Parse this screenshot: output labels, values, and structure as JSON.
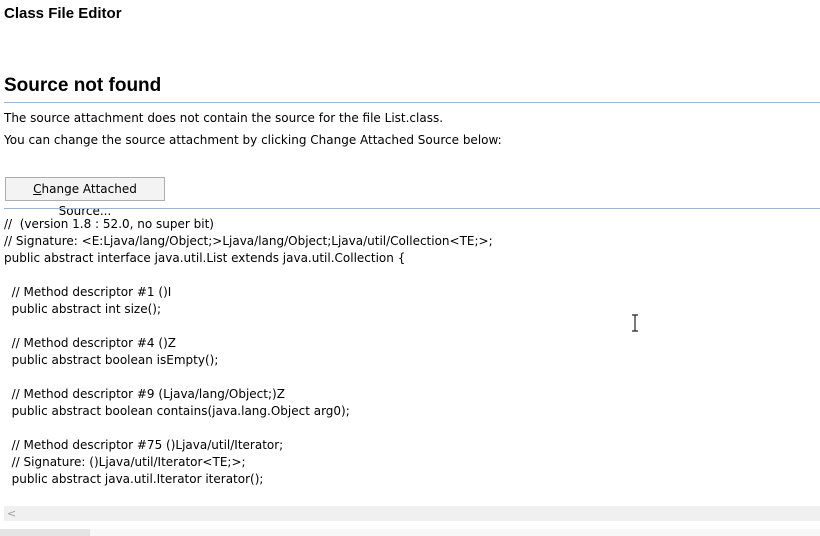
{
  "editor": {
    "title": "Class File Editor"
  },
  "source": {
    "heading": "Source not found",
    "message_1": "The source attachment does not contain the source for the file List.class.",
    "message_2": "You can change the source attachment by clicking Change Attached Source below:",
    "button_underlined": "C",
    "button_rest": "hange Attached Source..."
  },
  "code_lines": [
    "//  (version 1.8 : 52.0, no super bit)",
    "// Signature: <E:Ljava/lang/Object;>Ljava/lang/Object;Ljava/util/Collection<TE;>;",
    "public abstract interface java.util.List extends java.util.Collection {",
    "",
    "  // Method descriptor #1 ()I",
    "  public abstract int size();",
    "",
    "  // Method descriptor #4 ()Z",
    "  public abstract boolean isEmpty();",
    "",
    "  // Method descriptor #9 (Ljava/lang/Object;)Z",
    "  public abstract boolean contains(java.lang.Object arg0);",
    "",
    "  // Method descriptor #75 ()Ljava/util/Iterator;",
    "  // Signature: ()Ljava/util/Iterator<TE;>;",
    "  public abstract java.util.Iterator iterator();"
  ],
  "scrollbar": {
    "left_arrow": "<"
  },
  "colors": {
    "rule": "#9fb4cf",
    "button_bg": "#f3f3f3"
  },
  "icons": {
    "cursor": "text-cursor-icon"
  }
}
